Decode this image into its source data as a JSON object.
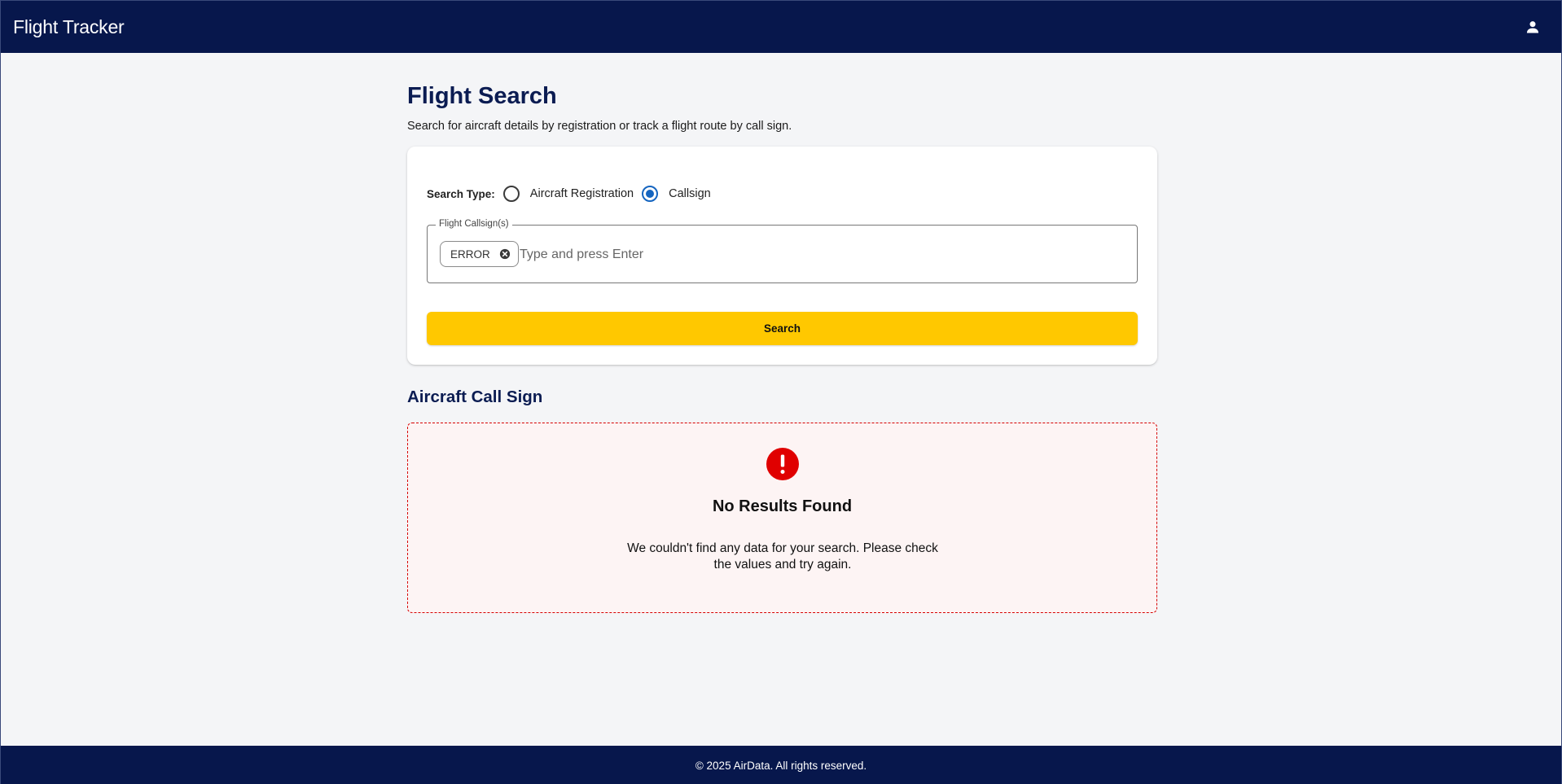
{
  "header": {
    "app_title": "Flight Tracker",
    "account_icon": "person-icon"
  },
  "main": {
    "title": "Flight Search",
    "subtitle": "Search for aircraft details by registration or track a flight route by call sign."
  },
  "search_form": {
    "search_type_label": "Search Type:",
    "options": [
      {
        "label": "Aircraft Registration",
        "selected": false
      },
      {
        "label": "Callsign",
        "selected": true
      }
    ],
    "field_label": "Flight Callsign(s)",
    "chips": [
      "ERROR"
    ],
    "input_value": "",
    "input_placeholder": "Type and press Enter",
    "search_button_label": "Search"
  },
  "results": {
    "section_title": "Aircraft Call Sign",
    "error_icon": "exclamation-circle-icon",
    "error_title": "No Results Found",
    "error_message": "We couldn't find any data for your search. Please check the values and try again."
  },
  "footer": {
    "copyright": "© 2025 AirData. All rights reserved."
  },
  "colors": {
    "header_bg": "#07174c",
    "footer_bg": "#07174c",
    "heading_text": "#0b1c52",
    "page_bg": "#f4f5f7",
    "accent_button": "#ffc800",
    "radio_selected": "#1565c0",
    "error_border": "#d60000",
    "error_icon": "#e00000",
    "error_bg": "#fdf4f4"
  }
}
